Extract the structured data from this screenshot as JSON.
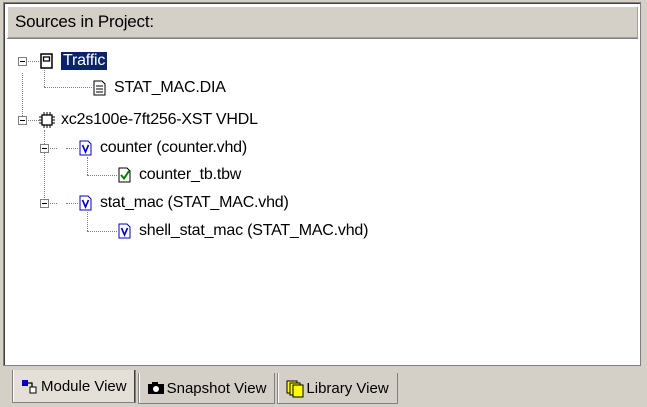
{
  "panel": {
    "title": "Sources in Project:"
  },
  "tree": [
    {
      "id": "traffic",
      "label": "Traffic",
      "icon": "project-icon",
      "selected": true,
      "expanded": true
    },
    {
      "id": "stat-mac-dia",
      "label": "STAT_MAC.DIA",
      "icon": "document-icon"
    },
    {
      "id": "device",
      "label": "xc2s100e-7ft256-XST VHDL",
      "icon": "chip-icon",
      "expanded": true
    },
    {
      "id": "counter",
      "label": "counter (counter.vhd)",
      "icon": "vhdl-module-icon",
      "expanded": true
    },
    {
      "id": "counter-tb",
      "label": "counter_tb.tbw",
      "icon": "testbench-icon"
    },
    {
      "id": "stat-mac",
      "label": "stat_mac (STAT_MAC.vhd)",
      "icon": "vhdl-module-icon",
      "expanded": true
    },
    {
      "id": "shell-stat-mac",
      "label": "shell_stat_mac (STAT_MAC.vhd)",
      "icon": "vhdl-module-icon"
    }
  ],
  "tabs": [
    {
      "label": "Module View",
      "icon": "module-view-icon",
      "active": true
    },
    {
      "label": "Snapshot View",
      "icon": "camera-icon",
      "active": false
    },
    {
      "label": "Library View",
      "icon": "library-icon",
      "active": false
    }
  ],
  "colors": {
    "selection": "#0a246a",
    "chrome": "#d4d0c8",
    "vhdl_blue": "#0000c0",
    "check_green": "#008000"
  }
}
